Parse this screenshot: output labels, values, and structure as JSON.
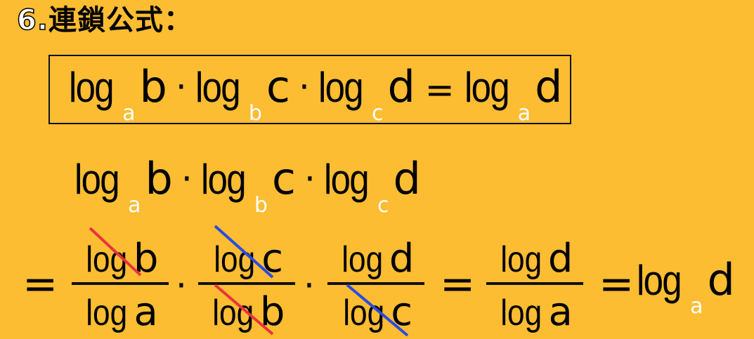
{
  "title": {
    "number": "6.",
    "text": "連鎖公式："
  },
  "formula": {
    "log": "log",
    "a": "a",
    "b": "b",
    "c": "c",
    "d": "d",
    "dot": "·",
    "eq": "="
  },
  "derivation": {
    "log": "log",
    "frac1": {
      "num": "b",
      "den": "a"
    },
    "frac2": {
      "num": "c",
      "den": "b"
    },
    "frac3": {
      "num": "d",
      "den": "c"
    },
    "frac4": {
      "num": "d",
      "den": "a"
    },
    "result_base": "a",
    "result_arg": "d"
  },
  "colors": {
    "background": "#FCBD32",
    "strike_red": "#E8343C",
    "strike_blue": "#2A4BE0",
    "subscript": "#FFFFFF"
  }
}
